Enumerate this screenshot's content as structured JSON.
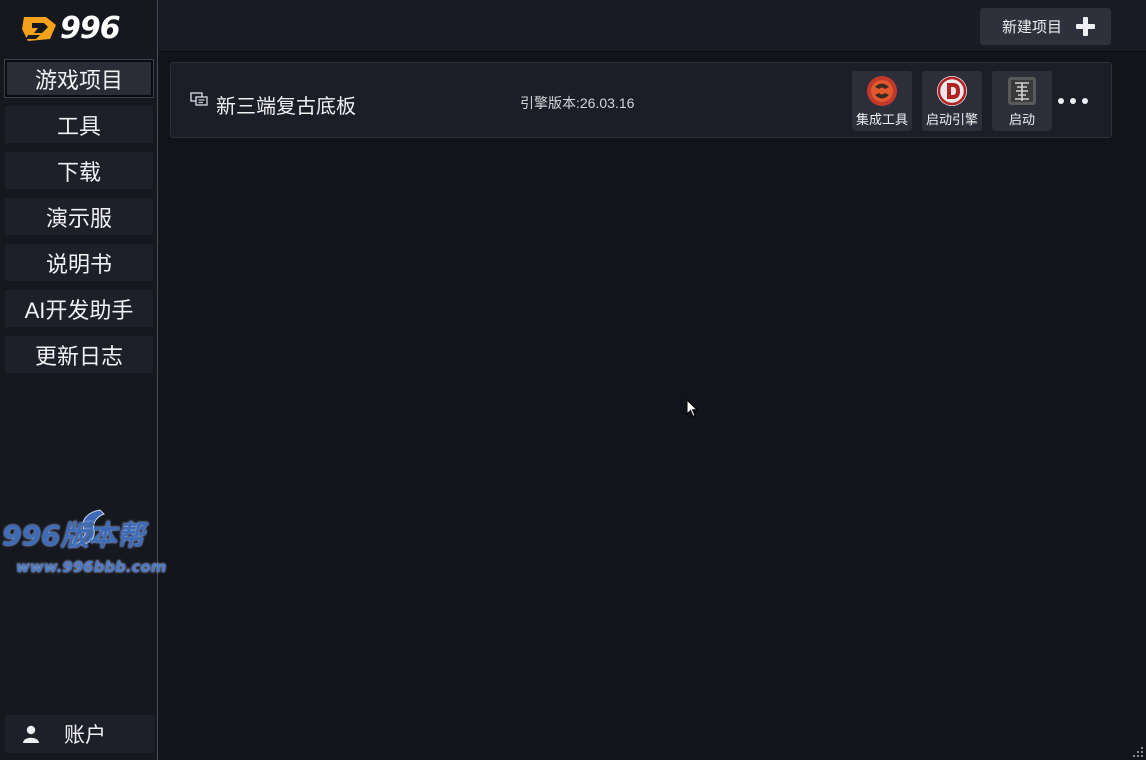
{
  "app": {
    "logo_text": "996"
  },
  "sidebar": {
    "items": [
      {
        "label": "游戏项目",
        "active": true
      },
      {
        "label": "工具"
      },
      {
        "label": "下载"
      },
      {
        "label": "演示服"
      },
      {
        "label": "说明书"
      },
      {
        "label": "AI开发助手"
      },
      {
        "label": "更新日志"
      }
    ],
    "watermark": {
      "title": "996版本帮",
      "url": "www.996bbb.com"
    },
    "account_label": "账户"
  },
  "toolbar": {
    "new_project_label": "新建项目"
  },
  "project": {
    "name": "新三端复古底板",
    "engine_version": "引擎版本:26.03.16",
    "actions": [
      {
        "label": "集成工具",
        "icon": "integration-tool-icon"
      },
      {
        "label": "启动引擎",
        "icon": "engine-d-icon"
      },
      {
        "label": "启动",
        "icon": "dragon-launch-icon"
      }
    ]
  },
  "colors": {
    "background": "#12131b",
    "sidebar": "#161820",
    "card": "#1c1e27",
    "button": "#2e303b",
    "logo_orange": "#f4a11c"
  }
}
